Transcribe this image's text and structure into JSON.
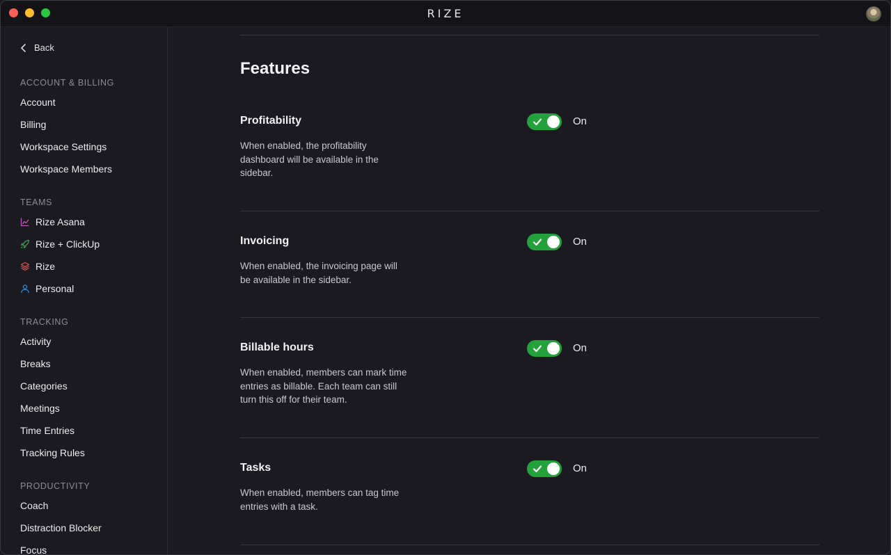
{
  "window": {
    "app_title": "RIZE"
  },
  "sidebar": {
    "back_label": "Back",
    "sections": {
      "account": {
        "label": "ACCOUNT & BILLING",
        "items": [
          "Account",
          "Billing",
          "Workspace Settings",
          "Workspace Members"
        ]
      },
      "teams": {
        "label": "TEAMS",
        "items": [
          {
            "label": "Rize Asana",
            "icon": "chart-line-icon",
            "color": "#c05ab8"
          },
          {
            "label": "Rize + ClickUp",
            "icon": "rocket-icon",
            "color": "#3fa35a"
          },
          {
            "label": "Rize",
            "icon": "layers-icon",
            "color": "#e0554f"
          },
          {
            "label": "Personal",
            "icon": "user-icon",
            "color": "#3b8fd6"
          }
        ]
      },
      "tracking": {
        "label": "TRACKING",
        "items": [
          "Activity",
          "Breaks",
          "Categories",
          "Meetings",
          "Time Entries",
          "Tracking Rules"
        ]
      },
      "productivity": {
        "label": "PRODUCTIVITY",
        "items": [
          "Coach",
          "Distraction Blocker",
          "Focus"
        ]
      }
    }
  },
  "main": {
    "title": "Features",
    "features": [
      {
        "name": "Profitability",
        "description": "When enabled, the profitability dashboard will be available in the sidebar.",
        "enabled": true,
        "state_label": "On"
      },
      {
        "name": "Invoicing",
        "description": "When enabled, the invoicing page will be available in the sidebar.",
        "enabled": true,
        "state_label": "On"
      },
      {
        "name": "Billable hours",
        "description": "When enabled, members can mark time entries as billable. Each team can still turn this off for their team.",
        "enabled": true,
        "state_label": "On"
      },
      {
        "name": "Tasks",
        "description": "When enabled, members can tag time entries with a task.",
        "enabled": true,
        "state_label": "On"
      }
    ]
  },
  "colors": {
    "toggle_on": "#23a23b",
    "background": "#1b1a20",
    "titlebar": "#141317"
  }
}
